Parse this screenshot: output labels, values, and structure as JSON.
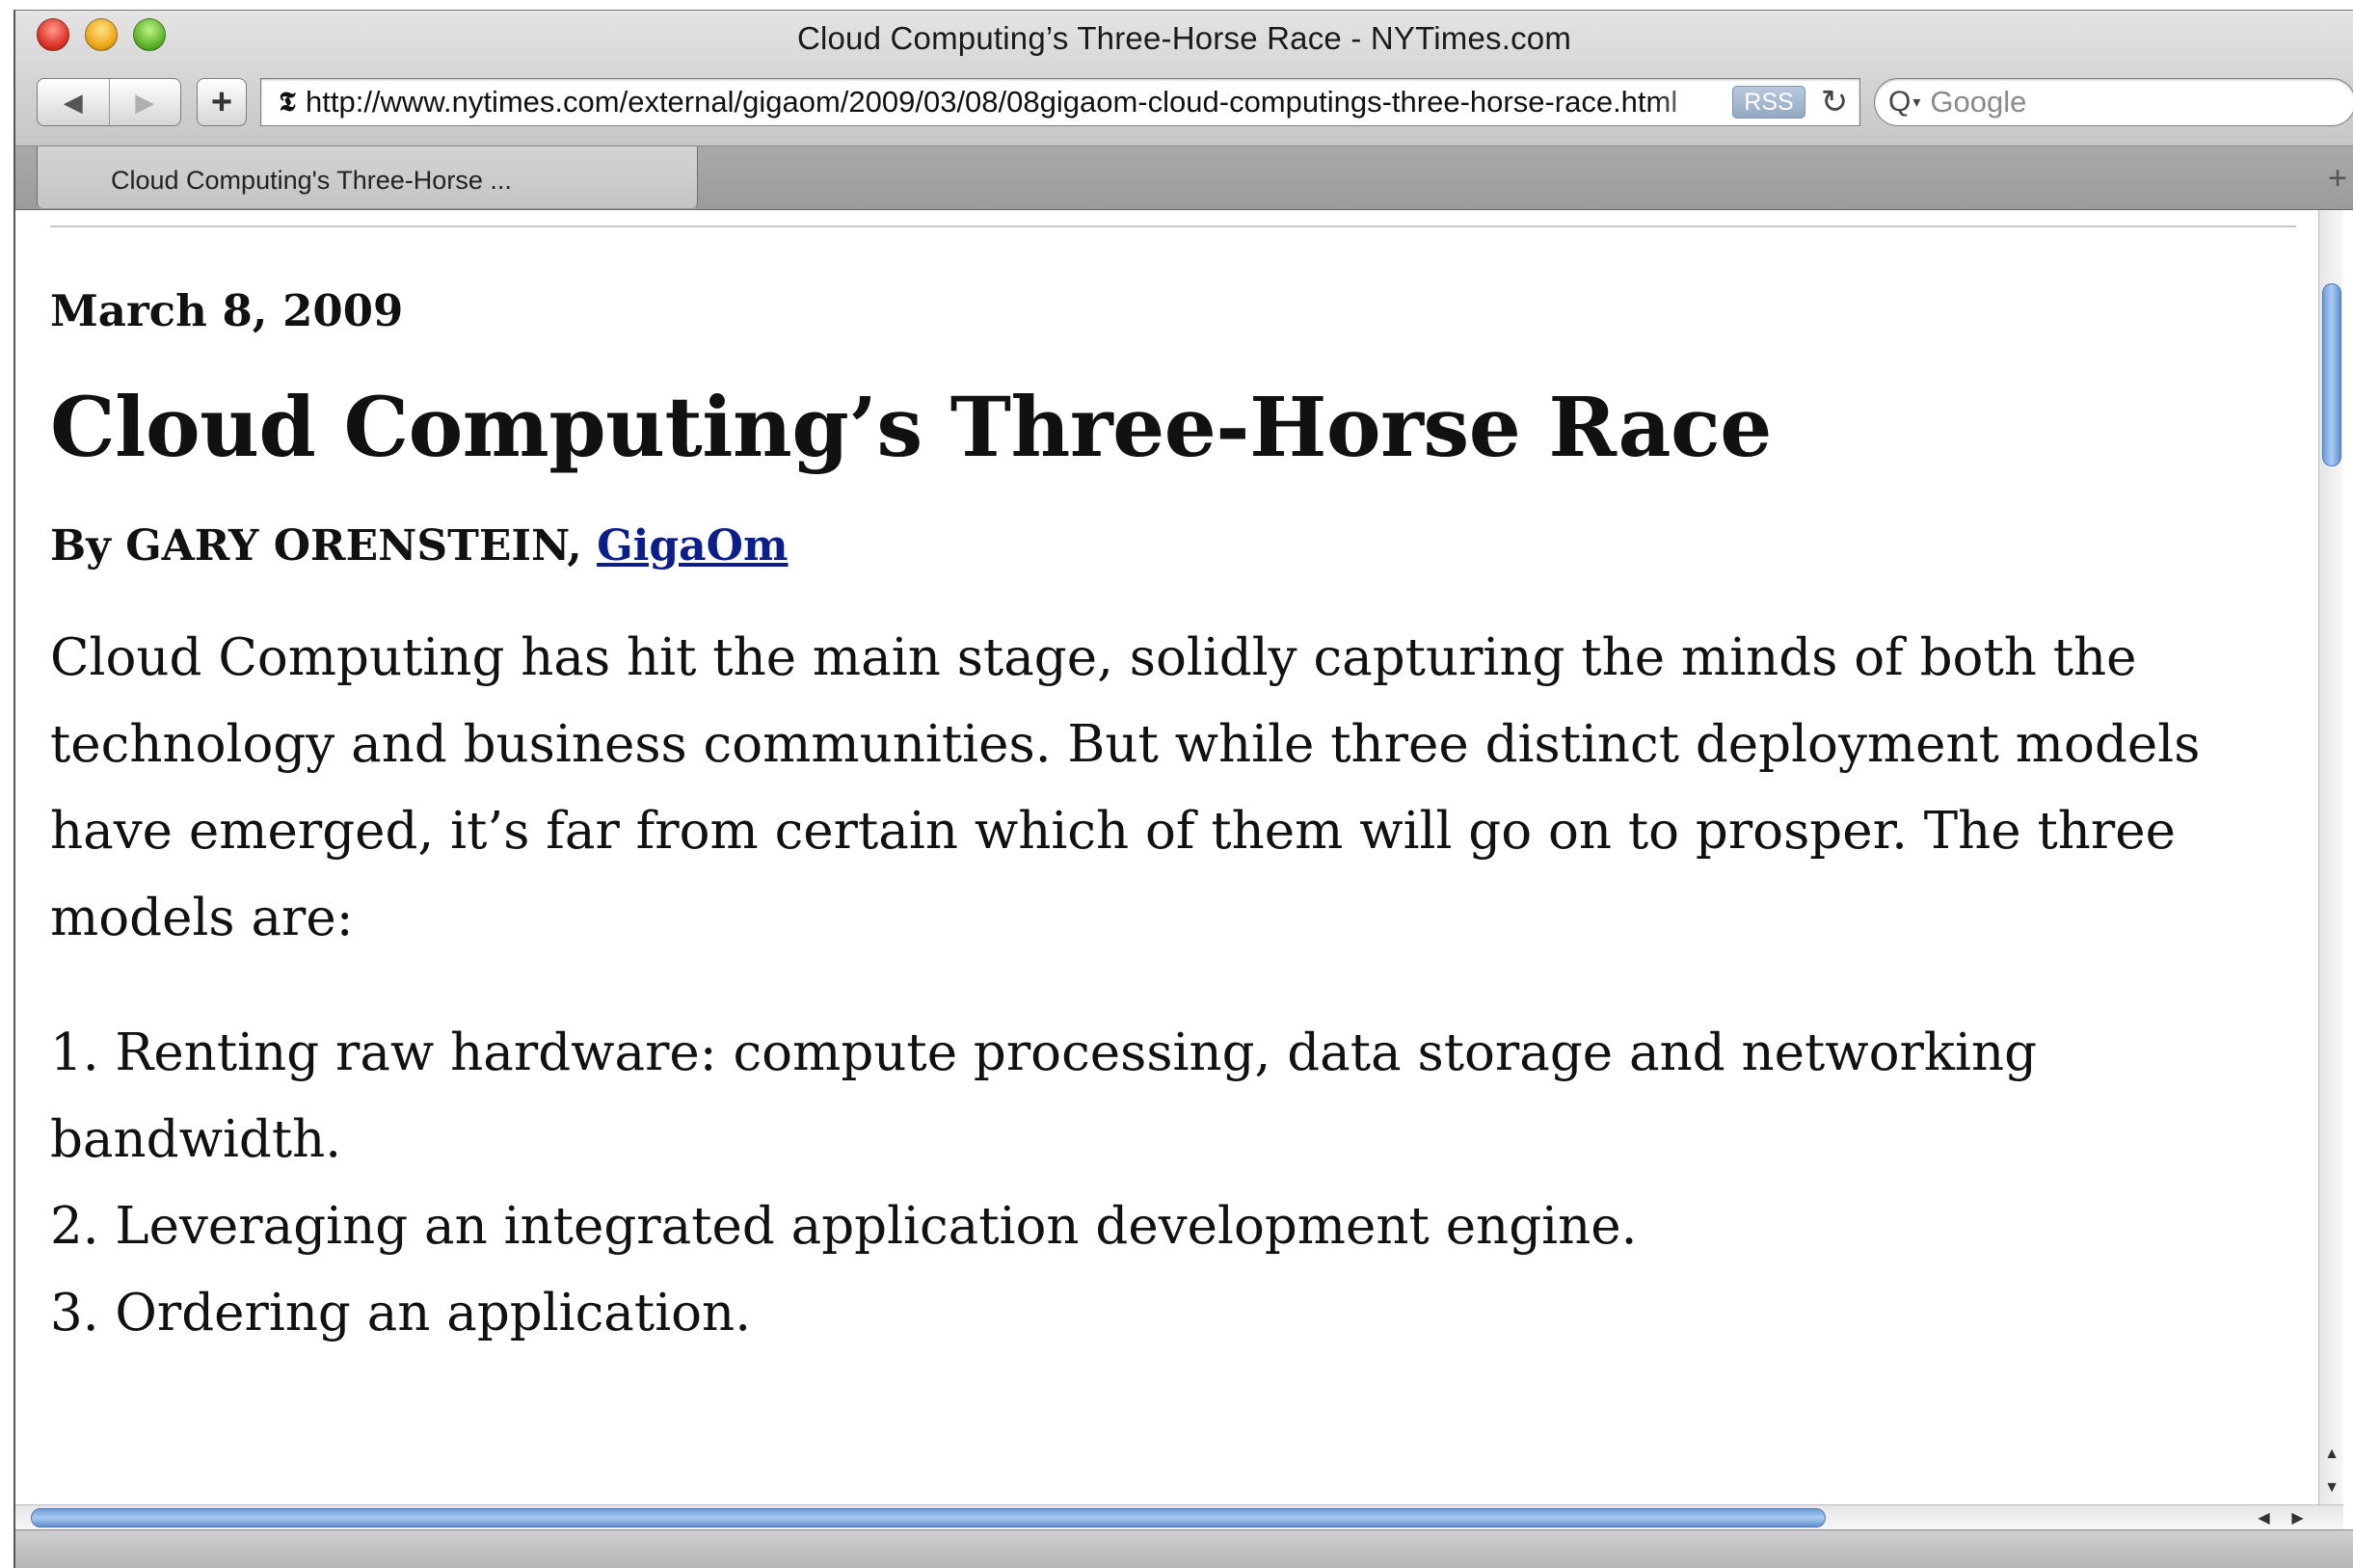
{
  "window": {
    "title": "Cloud Computing’s Three-Horse Race - NYTimes.com"
  },
  "toolbar": {
    "back_icon": "◀",
    "forward_icon": "▶",
    "add_icon": "+",
    "favicon": "𝕿",
    "url": "http://www.nytimes.com/external/gigaom/2009/03/08/08gigaom-cloud-computings-three-horse-race.html",
    "rss_label": "RSS",
    "reload_icon": "↻",
    "search_icon": "Q",
    "search_caret": "▾",
    "search_placeholder": "Google"
  },
  "tabs": {
    "items": [
      {
        "label": "Cloud Computing's Three-Horse ..."
      }
    ],
    "new_tab_icon": "+"
  },
  "article": {
    "date": "March 8, 2009",
    "headline": "Cloud Computing’s Three-Horse Race",
    "byline_prefix": "By GARY ORENSTEIN, ",
    "byline_link": "GigaOm",
    "intro": "Cloud Computing has hit the main stage, solidly capturing the minds of both the technology and business communities. But while three distinct deployment models have emerged, it’s far from certain which of them will go on to prosper. The three models are:",
    "models": [
      "1. Renting raw hardware: compute processing, data storage and networking bandwidth.",
      "2. Leveraging an integrated application development engine.",
      "3. Ordering an application."
    ]
  },
  "scrollbars": {
    "up_arrow": "▲",
    "down_arrow": "▼",
    "left_arrow": "◀",
    "right_arrow": "▶"
  }
}
